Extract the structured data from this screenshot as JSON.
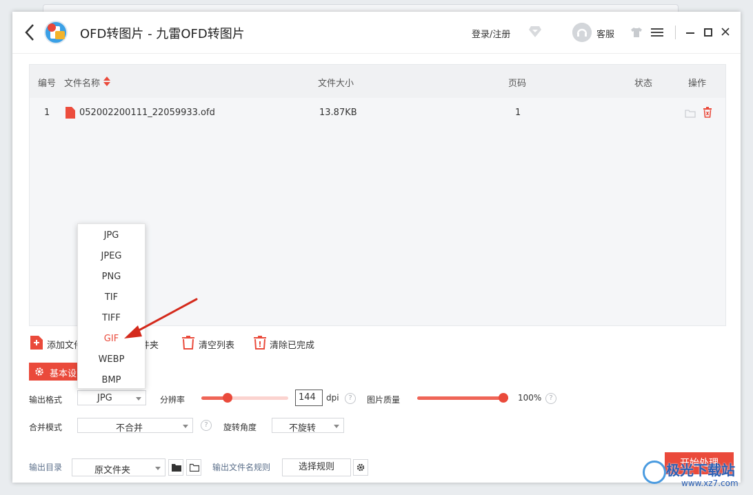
{
  "window": {
    "title": "OFD转图片 - 九雷OFD转图片",
    "login_label": "登录/注册",
    "support_label": "客服"
  },
  "table": {
    "headers": {
      "index": "编号",
      "name": "文件名称",
      "size": "文件大小",
      "pages": "页码",
      "status": "状态",
      "actions": "操作"
    },
    "rows": [
      {
        "index": "1",
        "name": "052002200111_22059933.ofd",
        "size": "13.87KB",
        "pages": "1",
        "status": ""
      }
    ]
  },
  "actions": {
    "add_file": "添加文件",
    "add_folder": "件夹",
    "clear_list": "清空列表",
    "clear_done": "清除已完成"
  },
  "settings": {
    "tab_label": "基本设",
    "output_format_label": "输出格式",
    "output_format_value": "JPG",
    "resolution_label": "分辨率",
    "resolution_value": "144",
    "resolution_unit": "dpi",
    "resolution_level": 0.3,
    "quality_label": "图片质量",
    "quality_value": "100%",
    "quality_level": 1.0,
    "merge_label": "合并模式",
    "merge_value": "不合并",
    "rotate_label": "旋转角度",
    "rotate_value": "不旋转"
  },
  "output": {
    "dir_label": "输出目录",
    "dir_value": "原文件夹",
    "rule_label": "输出文件名规则",
    "rule_button": "选择规则",
    "start_button": "开始处理"
  },
  "format_dropdown": {
    "options": [
      "JPG",
      "JPEG",
      "PNG",
      "TIF",
      "TIFF",
      "GIF",
      "WEBP",
      "BMP"
    ],
    "highlighted": "GIF"
  },
  "watermark": {
    "text": "极光下载站",
    "url": "www.xz7.com"
  },
  "colors": {
    "accent": "#ea4a3b",
    "slider_fill": "#ef6557",
    "table_bg": "#f5f6f8"
  }
}
